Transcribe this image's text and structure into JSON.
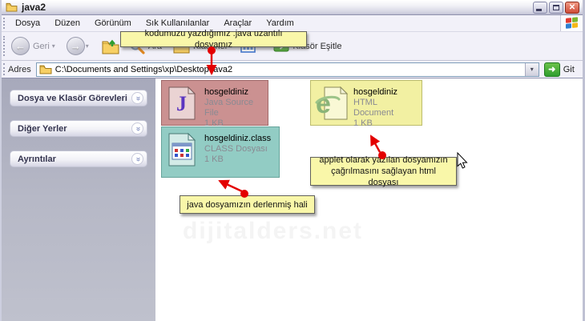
{
  "window": {
    "title": "java2",
    "controls": {
      "minimize": "minimize",
      "maximize": "maximize",
      "close_glyph": "✕"
    }
  },
  "menubar": {
    "items": [
      "Dosya",
      "Düzen",
      "Görünüm",
      "Sık Kullanılanlar",
      "Araçlar",
      "Yardım"
    ]
  },
  "toolbar": {
    "back_label": "Geri",
    "search_label": "Ara",
    "folders_label": "Klasörler",
    "sync_label": "Klasör Eşitle"
  },
  "addressbar": {
    "label": "Adres",
    "path": "C:\\Documents and Settings\\xp\\Desktop\\java2",
    "go_label": "Git"
  },
  "sidebar": {
    "panels": [
      {
        "label": "Dosya ve Klasör Görevleri"
      },
      {
        "label": "Diğer Yerler"
      },
      {
        "label": "Ayrıntılar"
      }
    ]
  },
  "files": [
    {
      "name": "hosgeldiniz",
      "type": "Java Source File",
      "size": "1 KB",
      "highlight_color": "#cb9191"
    },
    {
      "name": "hosgeldiniz.class",
      "type": "CLASS Dosyası",
      "size": "1 KB",
      "highlight_color": "#92ccc4"
    },
    {
      "name": "hosgeldiniz",
      "type": "HTML Document",
      "size": "1 KB",
      "highlight_color": "#f2f0a2"
    }
  ],
  "annotations": {
    "java_file": "kodumuzu yazdığımız .java uzantılı dosyamız",
    "class_file": "java dosyamızın derlenmiş hali",
    "html_file": "applet olarak yazılan dosyamızın çağrılmasını sağlayan html dosyası",
    "arrow_color": "#e30000"
  },
  "icons": {
    "caret_down": "▾",
    "chevron_double": "»",
    "back_arrow": "←",
    "forward_arrow": "→",
    "go_arrow": "➜"
  },
  "watermark": "dijitalders.net"
}
